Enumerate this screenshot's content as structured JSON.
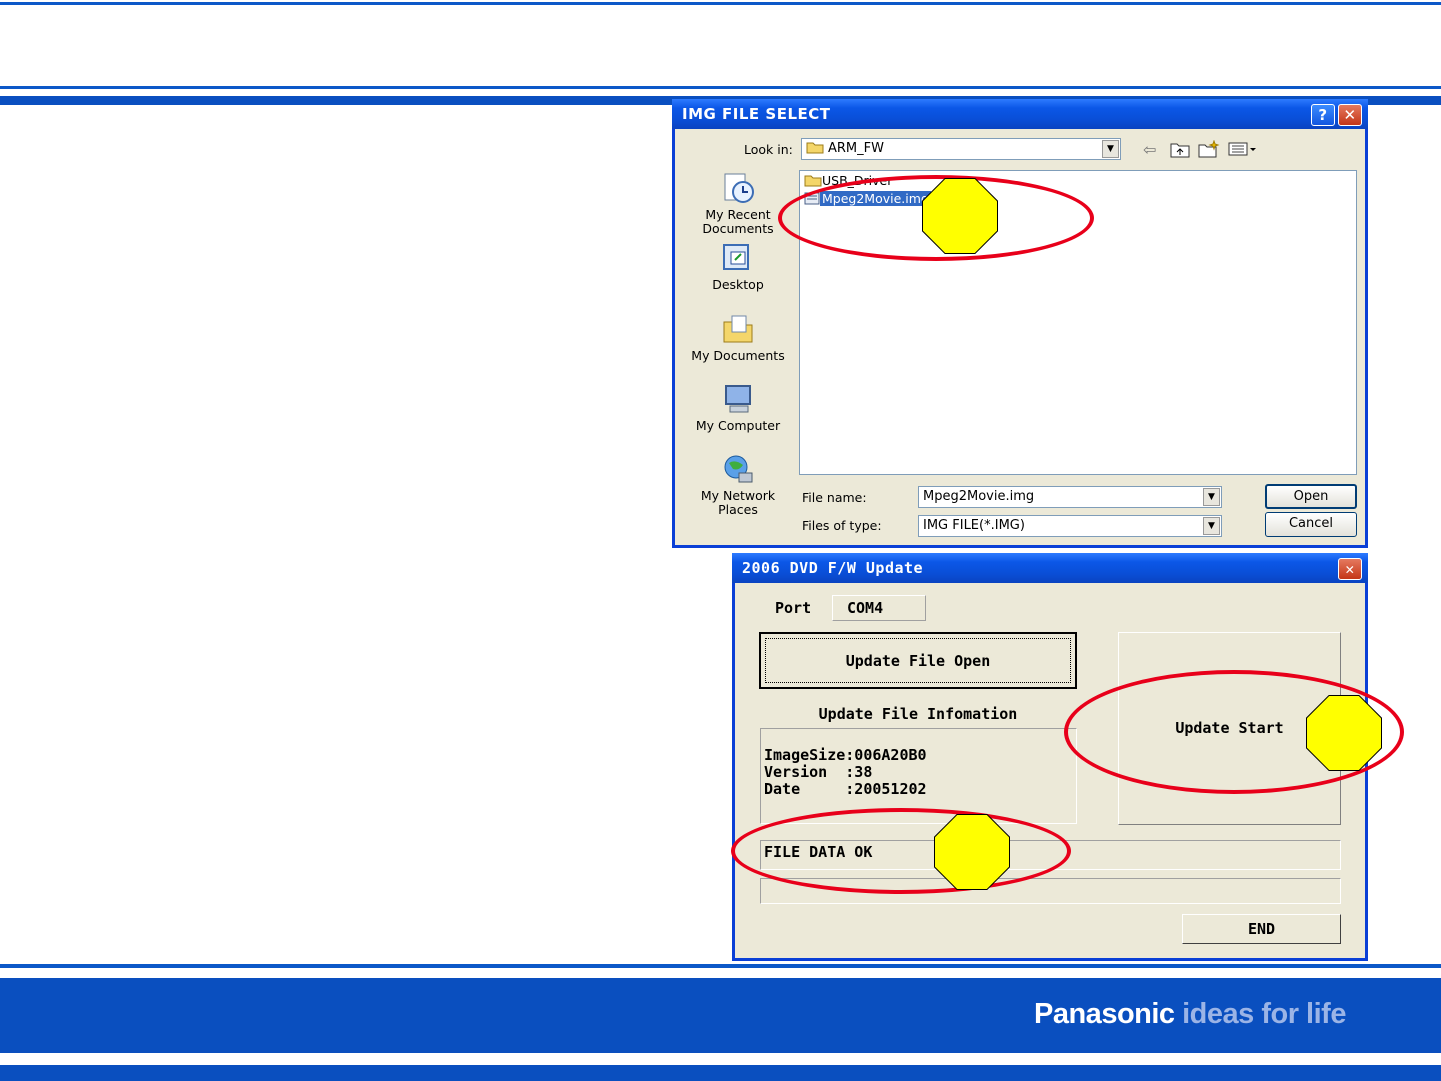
{
  "brand": {
    "part1": "Panasonic",
    "part2": " ideas for life"
  },
  "file_dialog": {
    "title": "IMG FILE SELECT",
    "help_button": "?",
    "close_button": "✕",
    "look_in_label": "Look in:",
    "look_in_value": "ARM_FW",
    "places": [
      {
        "label": "My Recent Documents",
        "icon": "recent-documents-icon"
      },
      {
        "label": "Desktop",
        "icon": "desktop-icon"
      },
      {
        "label": "My Documents",
        "icon": "my-documents-icon"
      },
      {
        "label": "My Computer",
        "icon": "my-computer-icon"
      },
      {
        "label": "My Network Places",
        "icon": "network-places-icon"
      }
    ],
    "files": [
      {
        "name": "USB_Driver",
        "type": "folder"
      },
      {
        "name": "Mpeg2Movie.img",
        "type": "img-file",
        "selected": true
      }
    ],
    "file_name_label": "File name:",
    "file_name_value": "Mpeg2Movie.img",
    "file_type_label": "Files of type:",
    "file_type_value": "IMG FILE(*.IMG)",
    "open_button": "Open",
    "cancel_button": "Cancel"
  },
  "update_window": {
    "title": "2006 DVD F/W Update",
    "close_button": "✕",
    "port_label": "Port",
    "port_value": "COM4",
    "open_button": "Update File Open",
    "info_title": "Update File Infomation",
    "info_lines": [
      "ImageSize:006A20B0",
      "Version  :38",
      "Date     :20051202"
    ],
    "start_button": "Update Start",
    "status_text": "FILE DATA OK",
    "progress_text": "",
    "end_button": "END"
  },
  "colors": {
    "frame_blue": "#0a4fbf",
    "annotation_red": "#e8001a",
    "marker_yellow": "#ffff00",
    "xp_title_blue": "#0b57e7",
    "selection_blue": "#316ac5"
  }
}
